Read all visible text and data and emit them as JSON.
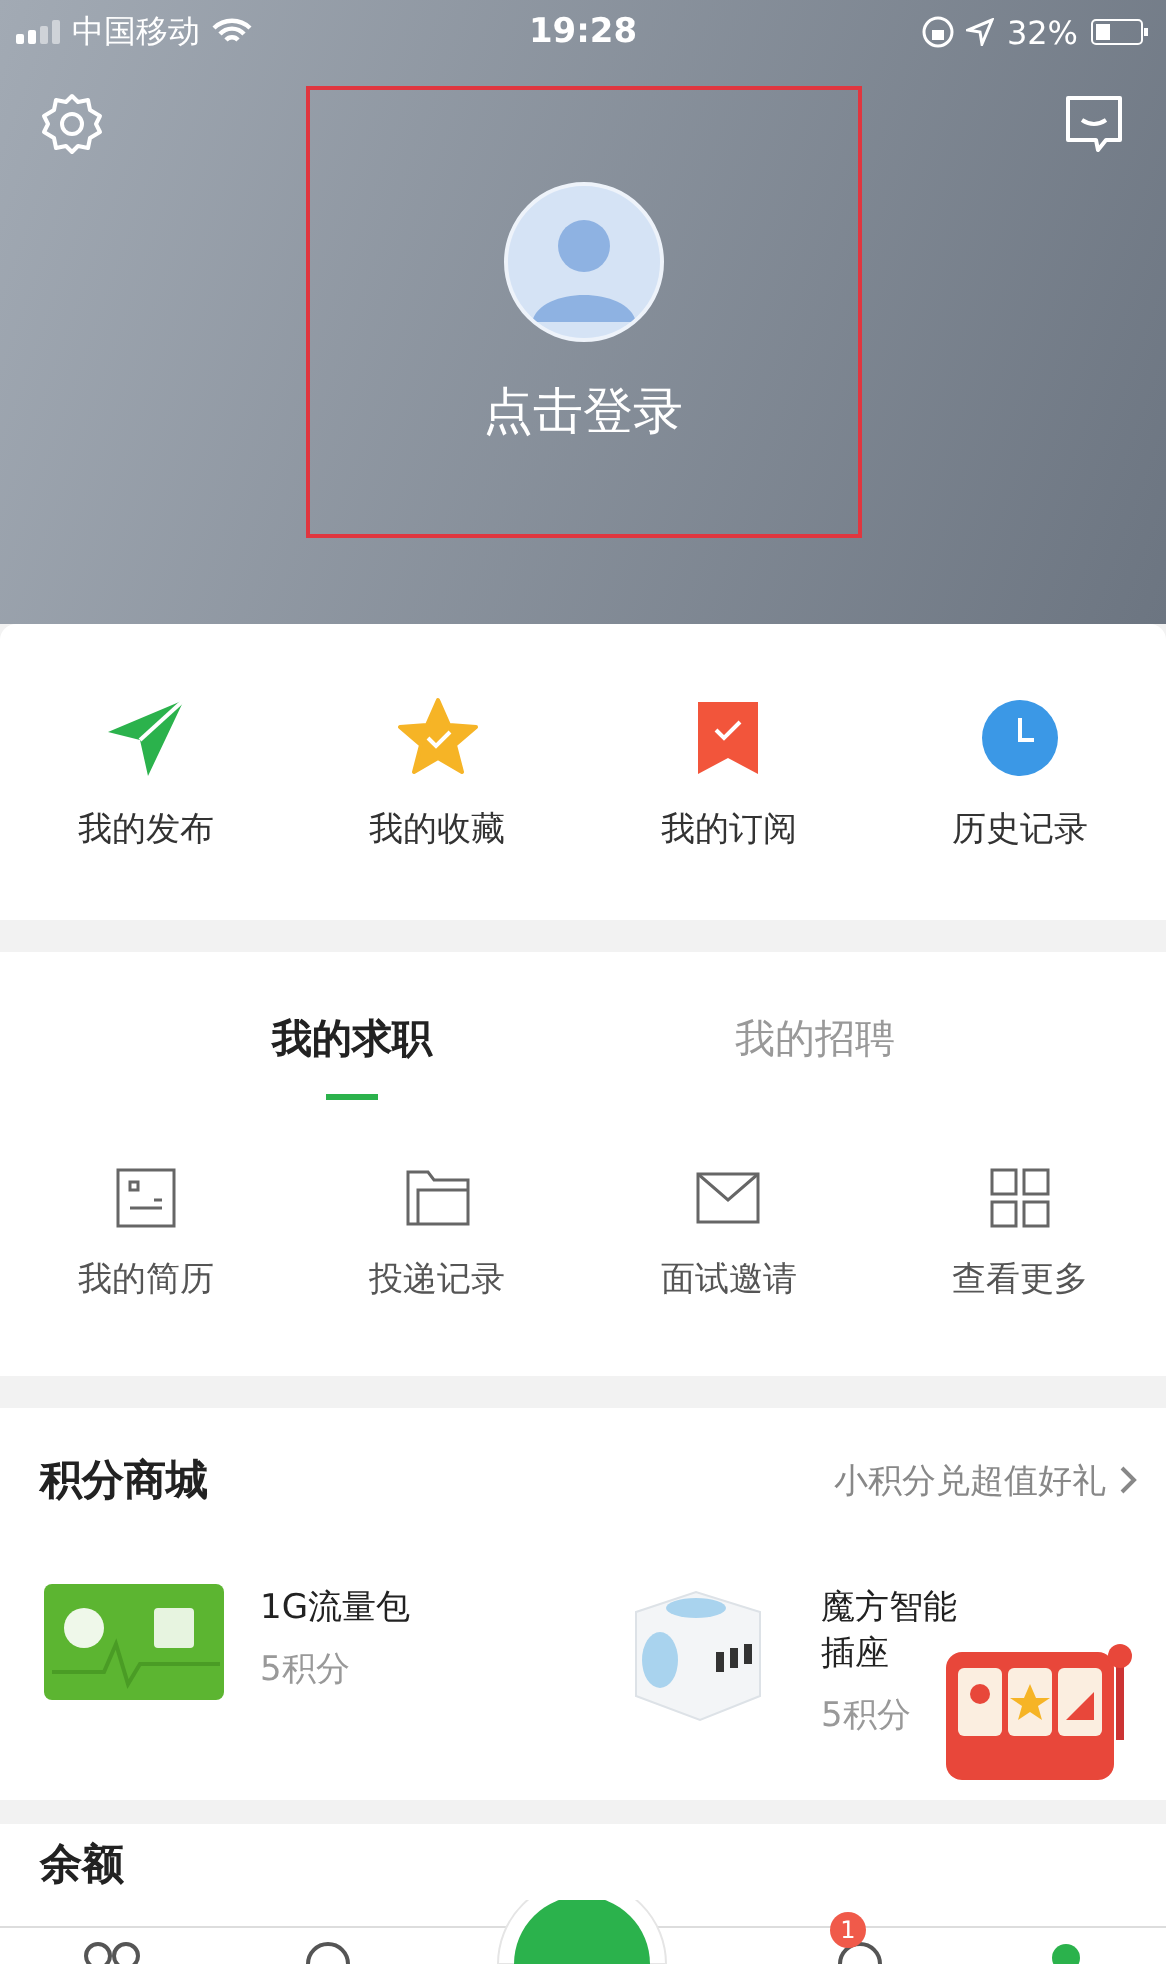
{
  "status_bar": {
    "carrier": "中国移动",
    "time": "19:28",
    "battery": "32%"
  },
  "header": {
    "login_label": "点击登录"
  },
  "quick_links": [
    {
      "label": "我的发布"
    },
    {
      "label": "我的收藏"
    },
    {
      "label": "我的订阅"
    },
    {
      "label": "历史记录"
    }
  ],
  "job_tabs": [
    {
      "label": "我的求职",
      "selected": true
    },
    {
      "label": "我的招聘",
      "selected": false
    }
  ],
  "job_links": [
    {
      "label": "我的简历"
    },
    {
      "label": "投递记录"
    },
    {
      "label": "面试邀请"
    },
    {
      "label": "查看更多"
    }
  ],
  "points_mall": {
    "title": "积分商城",
    "link": "小积分兑超值好礼",
    "products": [
      {
        "name": "1G流量包",
        "price": "5积分",
        "kind": "data"
      },
      {
        "name": "魔方智能插座",
        "price": "5积分",
        "kind": "socket"
      }
    ]
  },
  "balance": {
    "title": "余额"
  },
  "tab_bar": {
    "badge": "1"
  }
}
